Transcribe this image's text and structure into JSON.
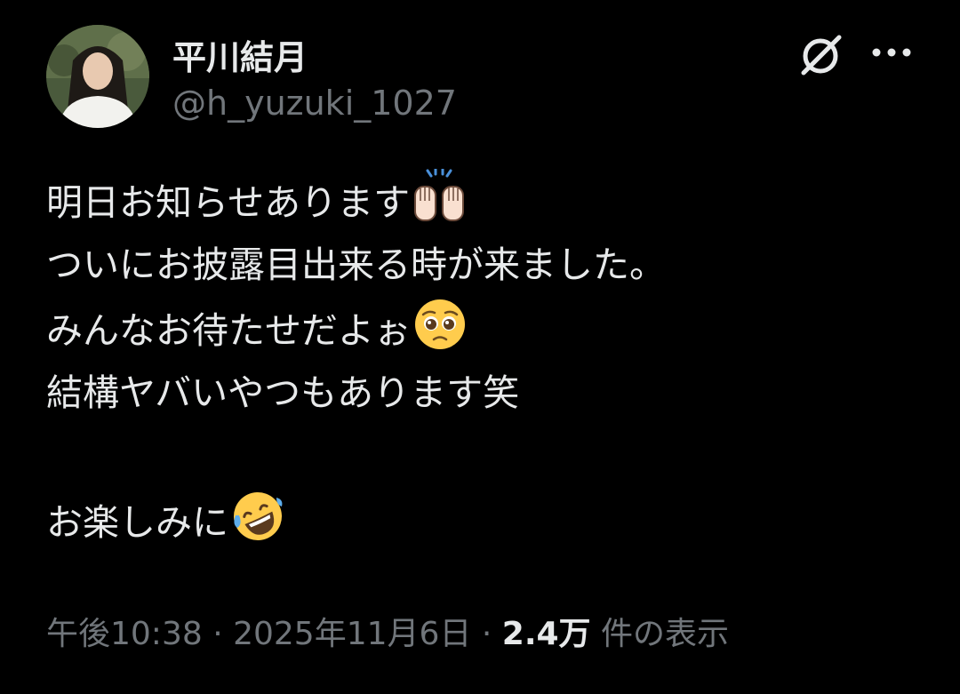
{
  "author": {
    "display_name": "平川結月",
    "handle": "@h_yuzuki_1027",
    "avatar_icon": "profile-photo"
  },
  "header_actions": {
    "grok_icon": "grok-icon",
    "more_icon": "more-horizontal-icon"
  },
  "tweet": {
    "lines": [
      {
        "text": "明日お知らせあります",
        "emoji": "raising-hands-emoji"
      },
      {
        "text": "ついにお披露目出来る時が来ました。",
        "emoji": ""
      },
      {
        "text": "みんなお待たせだよぉ",
        "emoji": "pleading-face-emoji"
      },
      {
        "text": "結構ヤバいやつもあります笑",
        "emoji": ""
      },
      {
        "text": "",
        "emoji": ""
      },
      {
        "text": "お楽しみに",
        "emoji": "rolling-on-floor-laughing-emoji"
      }
    ]
  },
  "meta": {
    "time": "午後10:38",
    "separator": " · ",
    "date": "2025年11月6日",
    "views_count": "2.4万",
    "views_label": " 件の表示"
  },
  "colors": {
    "background": "#000000",
    "primary_text": "#e7e9ea",
    "secondary_text": "#71767b"
  }
}
